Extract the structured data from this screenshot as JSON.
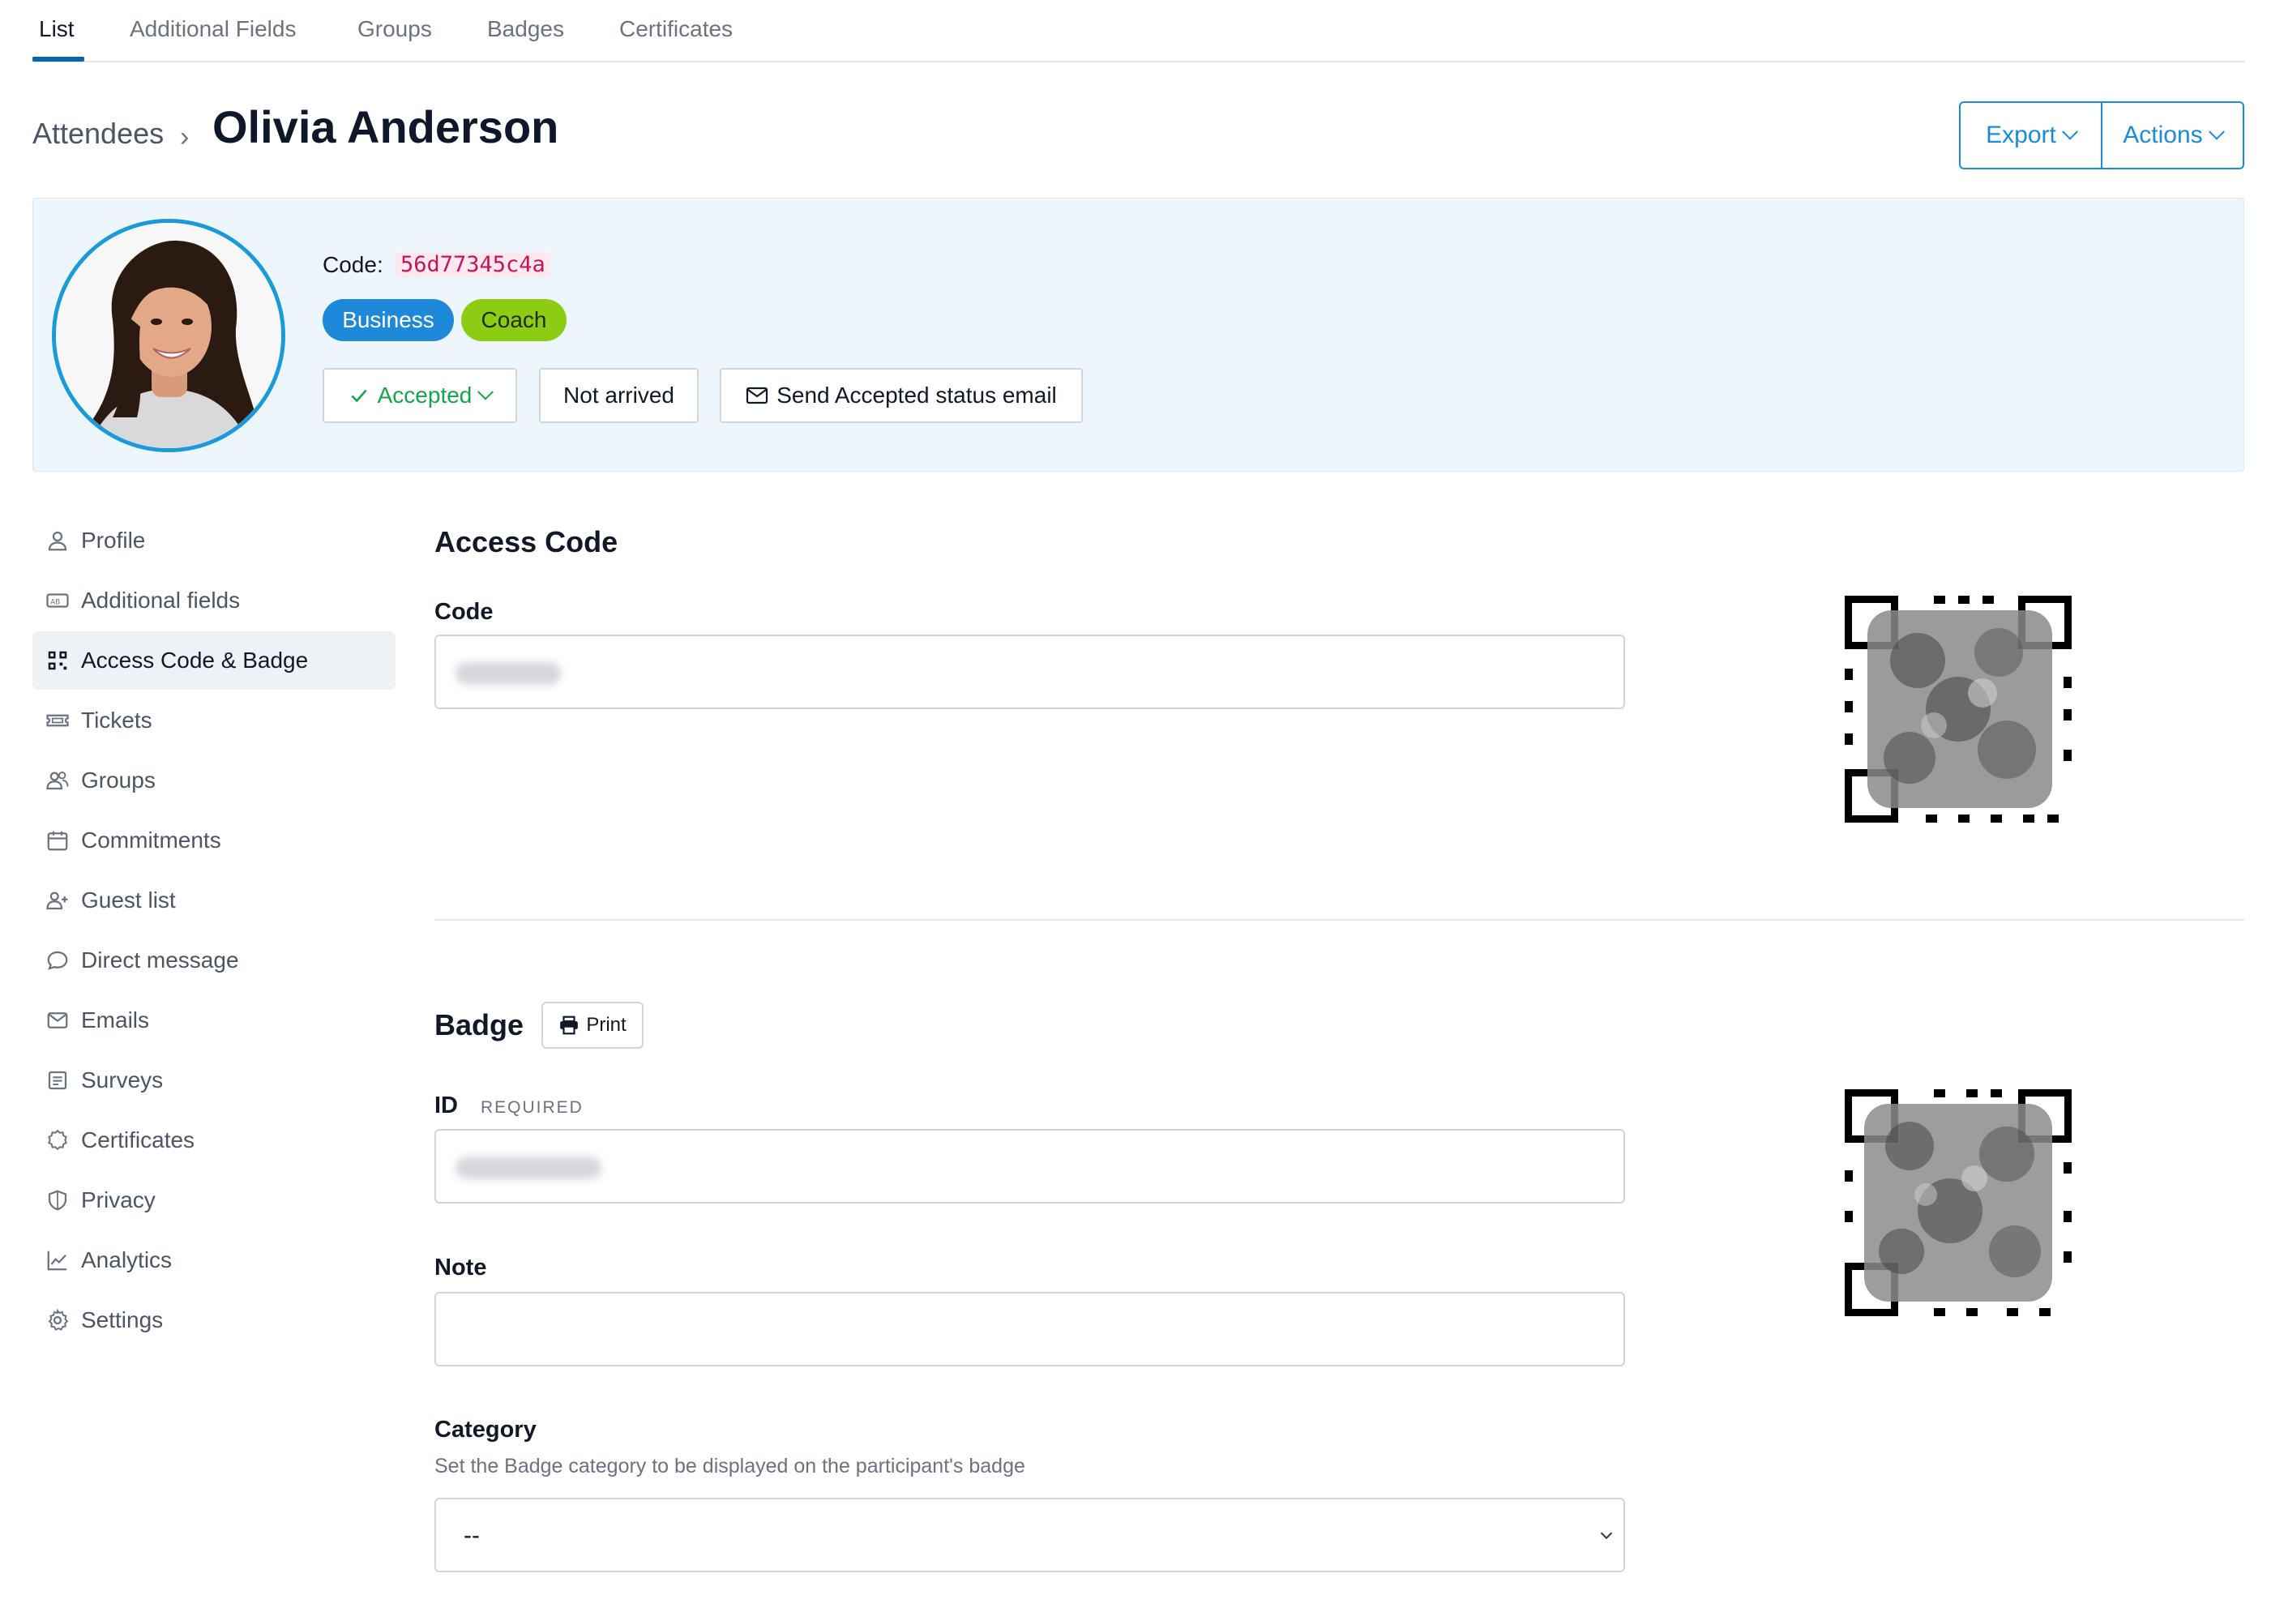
{
  "tabs": {
    "list": "List",
    "additional_fields": "Additional Fields",
    "groups": "Groups",
    "badges": "Badges",
    "certificates": "Certificates"
  },
  "header": {
    "breadcrumb": "Attendees",
    "title": "Olivia Anderson",
    "export_label": "Export",
    "actions_label": "Actions"
  },
  "attendee": {
    "code_label": "Code:",
    "code_value": "56d77345c4a",
    "groups": [
      "Business",
      "Coach"
    ],
    "status_label": "Accepted",
    "arrival_label": "Not arrived",
    "send_email_label": "Send Accepted status email"
  },
  "sidebar": {
    "items": [
      {
        "label": "Profile",
        "icon": "user-icon"
      },
      {
        "label": "Additional fields",
        "icon": "form-field-icon"
      },
      {
        "label": "Access Code & Badge",
        "icon": "qr-code-icon",
        "active": true
      },
      {
        "label": "Tickets",
        "icon": "ticket-icon"
      },
      {
        "label": "Groups",
        "icon": "users-icon"
      },
      {
        "label": "Commitments",
        "icon": "calendar-icon"
      },
      {
        "label": "Guest list",
        "icon": "user-plus-icon"
      },
      {
        "label": "Direct message",
        "icon": "chat-bubble-icon"
      },
      {
        "label": "Emails",
        "icon": "envelope-icon"
      },
      {
        "label": "Surveys",
        "icon": "survey-icon"
      },
      {
        "label": "Certificates",
        "icon": "certificate-icon"
      },
      {
        "label": "Privacy",
        "icon": "shield-icon"
      },
      {
        "label": "Analytics",
        "icon": "line-chart-icon"
      },
      {
        "label": "Settings",
        "icon": "gear-icon"
      }
    ]
  },
  "access_code": {
    "heading": "Access Code",
    "code_label": "Code"
  },
  "badge": {
    "heading": "Badge",
    "print_label": "Print",
    "id_label": "ID",
    "id_required": "REQUIRED",
    "note_label": "Note",
    "category_label": "Category",
    "category_help": "Set the Badge category to be displayed on the participant's badge",
    "category_value": "--"
  },
  "colors": {
    "accent": "#1a8cd8",
    "business_pill": "#1e88d9",
    "coach_pill": "#8ccc12",
    "accepted_text": "#16a34a",
    "code_text": "#c2185b",
    "card_bg": "#eef6fd"
  }
}
